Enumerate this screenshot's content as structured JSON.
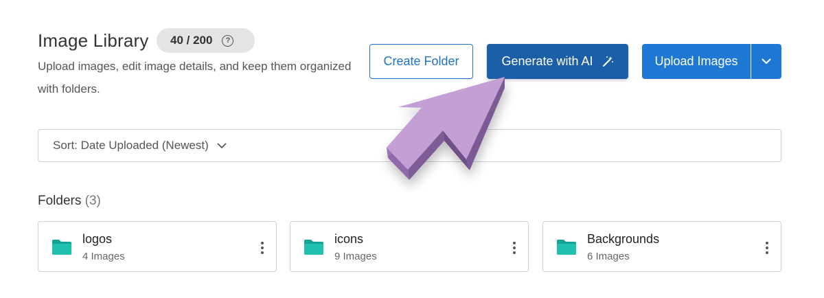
{
  "header": {
    "title": "Image Library",
    "quota": "40 / 200",
    "subtitle": "Upload images, edit image details, and keep them organized with folders."
  },
  "actions": {
    "create_folder": "Create Folder",
    "generate_ai": "Generate with AI",
    "upload_images": "Upload Images"
  },
  "sort": {
    "label": "Sort: Date Uploaded (Newest)"
  },
  "folders": {
    "heading": "Folders",
    "count": "(3)",
    "items": [
      {
        "name": "logos",
        "count": "4 Images"
      },
      {
        "name": "icons",
        "count": "9 Images"
      },
      {
        "name": "Backgrounds",
        "count": "6 Images"
      }
    ]
  },
  "colors": {
    "primary": "#1e78d4",
    "ai_button": "#1b5fa8",
    "folder_icon": "#1fb5a6",
    "pointer": "#c39fd5"
  },
  "icons": [
    "help-icon",
    "magic-wand-icon",
    "chevron-down-icon",
    "folder-icon",
    "kebab-menu-icon",
    "pointer-arrow-icon"
  ]
}
